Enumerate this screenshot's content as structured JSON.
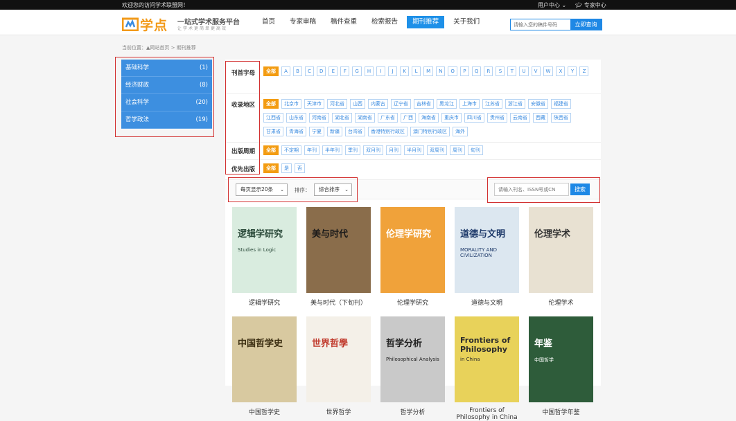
{
  "topbar": {
    "welcome": "欢迎您的访问学术联盟网！",
    "user_center": "用户中心 ⌄",
    "expert_center": "专家中心"
  },
  "logo": {
    "name": "学点",
    "slogan": "一站式学术服务平台",
    "sub": "让学术更简单更高效"
  },
  "nav": [
    {
      "label": "首页",
      "active": false
    },
    {
      "label": "专家审稿",
      "active": false
    },
    {
      "label": "稿件查重",
      "active": false
    },
    {
      "label": "检索报告",
      "active": false
    },
    {
      "label": "期刊推荐",
      "active": true
    },
    {
      "label": "关于我们",
      "active": false
    }
  ],
  "header_search": {
    "placeholder": "请输入您的稿件号码",
    "button": "立即查询"
  },
  "breadcrumb": "当前位置：▲网站首页 > 期刊推荐",
  "sidebar": [
    {
      "label": "基础科学",
      "count": "(1)"
    },
    {
      "label": "经济财政",
      "count": "(8)"
    },
    {
      "label": "社会科学",
      "count": "(20)"
    },
    {
      "label": "哲学政法",
      "count": "(19)"
    }
  ],
  "filters": {
    "letter": {
      "label": "刊首字母",
      "items": [
        "全部",
        "A",
        "B",
        "C",
        "D",
        "E",
        "F",
        "G",
        "H",
        "I",
        "J",
        "K",
        "L",
        "M",
        "N",
        "O",
        "P",
        "Q",
        "R",
        "S",
        "T",
        "U",
        "V",
        "W",
        "X",
        "Y",
        "Z"
      ]
    },
    "region": {
      "label": "收录地区",
      "items": [
        "全部",
        "北京市",
        "天津市",
        "河北省",
        "山西",
        "内蒙古",
        "辽宁省",
        "吉林省",
        "黑龙江",
        "上海市",
        "江苏省",
        "浙江省",
        "安徽省",
        "福建省",
        "江西省",
        "山东省",
        "河南省",
        "湖北省",
        "湖南省",
        "广东省",
        "广西",
        "海南省",
        "重庆市",
        "四川省",
        "贵州省",
        "云南省",
        "西藏",
        "陕西省",
        "甘肃省",
        "青海省",
        "宁夏",
        "新疆",
        "台湾省",
        "香港特别行政区",
        "澳门特别行政区",
        "海外"
      ]
    },
    "period": {
      "label": "出版周期",
      "items": [
        "全部",
        "不定期",
        "年刊",
        "半年刊",
        "季刊",
        "双月刊",
        "月刊",
        "半月刊",
        "双周刊",
        "周刊",
        "旬刊"
      ]
    },
    "priority": {
      "label": "优先出版",
      "items": [
        "全部",
        "是",
        "否"
      ]
    }
  },
  "toolbar": {
    "per_page": "每页显示20条",
    "sort_label": "排序：",
    "sort": "综合排序",
    "search_placeholder": "请输入刊名、ISSN号或CN",
    "search_button": "搜索"
  },
  "journals": [
    {
      "name": "逻辑学研究",
      "cover_title": "逻辑学研究",
      "cover_sub": "Studies in Logic",
      "bg": "#d9ecdf",
      "color": "#2b4a3a"
    },
    {
      "name": "美与时代（下旬刊）",
      "cover_title": "美与时代",
      "cover_sub": "",
      "bg": "#8a6d4b",
      "color": "#1a1a1a"
    },
    {
      "name": "伦理学研究",
      "cover_title": "伦理学研究",
      "cover_sub": "",
      "bg": "#f0a23a",
      "color": "#ffffff"
    },
    {
      "name": "道德与文明",
      "cover_title": "道德与文明",
      "cover_sub": "MORALITY AND CIVILIZATION",
      "bg": "#dce7f0",
      "color": "#1e3a6a"
    },
    {
      "name": "伦理学术",
      "cover_title": "伦理学术",
      "cover_sub": "",
      "bg": "#e8e1d2",
      "color": "#333333"
    },
    {
      "name": "中国哲学史",
      "cover_title": "中国哲学史",
      "cover_sub": "",
      "bg": "#d8c9a0",
      "color": "#3a2d10"
    },
    {
      "name": "世界哲学",
      "cover_title": "世界哲學",
      "cover_sub": "",
      "bg": "#f4f0e8",
      "color": "#c0392b"
    },
    {
      "name": "哲学分析",
      "cover_title": "哲学分析",
      "cover_sub": "Philosophical Analysis",
      "bg": "#c9c9c9",
      "color": "#222222"
    },
    {
      "name": "Frontiers of Philosophy in China",
      "cover_title": "Frontiers of Philosophy",
      "cover_sub": "in China",
      "bg": "#e8d25a",
      "color": "#2c2c2c"
    },
    {
      "name": "中国哲学年鉴",
      "cover_title": "年鉴",
      "cover_sub": "中国哲学",
      "bg": "#2e5c3a",
      "color": "#ffffff"
    }
  ]
}
